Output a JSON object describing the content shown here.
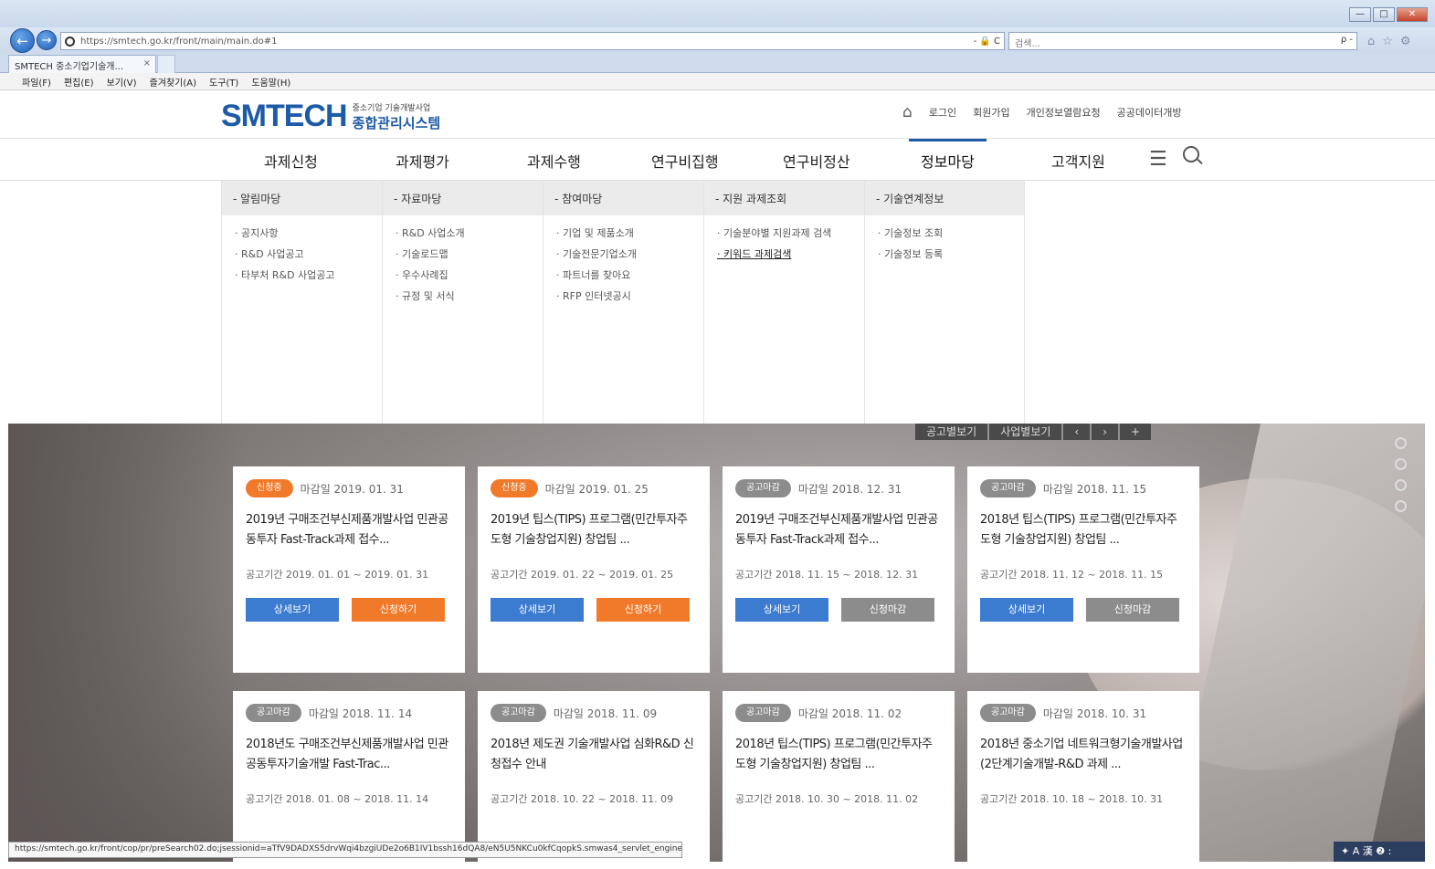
{
  "browser": {
    "url": "https://smtech.go.kr/front/main/main.do#1",
    "url_tail": "- 🔒 C",
    "search_placeholder": "검색...",
    "search_go": "ρ -",
    "tab_title": "SMTECH 중소기업기술개...",
    "menu": [
      "파일(F)",
      "편집(E)",
      "보기(V)",
      "즐겨찾기(A)",
      "도구(T)",
      "도움말(H)"
    ],
    "win_min": "—",
    "win_max": "□",
    "win_close": "✕",
    "tab_close": "×"
  },
  "header": {
    "logo_main": "SMTECH",
    "logo_sub1": "중소기업 기술개발사업",
    "logo_sub2": "종합관리시스템",
    "util": [
      "로그인",
      "회원가입",
      "개인정보열람요청",
      "공공데이터개방"
    ]
  },
  "gnb": [
    "과제신청",
    "과제평가",
    "과제수행",
    "연구비집행",
    "연구비정산",
    "정보마당",
    "고객지원"
  ],
  "mega_menu": [
    {
      "head": "- 알림마당",
      "items": [
        "· 공지사항",
        "· R&D 사업공고",
        "· 타부처 R&D 사업공고"
      ]
    },
    {
      "head": "- 자료마당",
      "items": [
        "· R&D 사업소개",
        "· 기술로드맵",
        "· 우수사례집",
        "· 규정 및 서식"
      ]
    },
    {
      "head": "- 참여마당",
      "items": [
        "· 기업 및 제품소개",
        "· 기술전문기업소개",
        "· 파트너를 찾아요",
        "· RFP 인터넷공시"
      ]
    },
    {
      "head": "- 지원 과제조회",
      "items": [
        "· 기술분야별 지원과제 검색",
        "· 키워드 과제검색"
      ]
    },
    {
      "head": "- 기술연계정보",
      "items": [
        "· 기술정보 조회",
        "· 기술정보 등록"
      ]
    }
  ],
  "hero": {
    "btn_notice": "공고별보기",
    "btn_business": "사업별보기",
    "prev": "‹",
    "next": "›",
    "plus": "+"
  },
  "cards": [
    {
      "badge": "신청중",
      "deadline": "마감일 2019. 01. 31",
      "title": "2019년 구매조건부신제품개발사업 민관공동투자 Fast-Track과제 접수...",
      "period": "공고기간 2019. 01. 01 ~ 2019. 01. 31",
      "detail": "상세보기",
      "apply": "신청하기"
    },
    {
      "badge": "신청중",
      "deadline": "마감일 2019. 01. 25",
      "title": "2019년 팁스(TIPS) 프로그램(민간투자주도형 기술창업지원) 창업팀 ...",
      "period": "공고기간 2019. 01. 22 ~ 2019. 01. 25",
      "detail": "상세보기",
      "apply": "신청하기"
    },
    {
      "badge": "공고마감",
      "deadline": "마감일 2018. 12. 31",
      "title": "2019년 구매조건부신제품개발사업 민관공동투자 Fast-Track과제 접수...",
      "period": "공고기간 2018. 11. 15 ~ 2018. 12. 31",
      "detail": "상세보기",
      "apply": "신청마감"
    },
    {
      "badge": "공고마감",
      "deadline": "마감일 2018. 11. 15",
      "title": "2018년 팁스(TIPS) 프로그램(민간투자주도형 기술창업지원) 창업팀 ...",
      "period": "공고기간 2018. 11. 12 ~ 2018. 11. 15",
      "detail": "상세보기",
      "apply": "신청마감"
    },
    {
      "badge": "공고마감",
      "deadline": "마감일 2018. 11. 14",
      "title": "2018년도 구매조건부신제품개발사업 민관공동투자기술개발 Fast-Trac...",
      "period": "공고기간 2018. 01. 08 ~ 2018. 11. 14"
    },
    {
      "badge": "공고마감",
      "deadline": "마감일 2018. 11. 09",
      "title": "2018년 제도권 기술개발사업 심화R&D 신청접수 안내",
      "period": "공고기간 2018. 10. 22 ~ 2018. 11. 09"
    },
    {
      "badge": "공고마감",
      "deadline": "마감일 2018. 11. 02",
      "title": "2018년 팁스(TIPS) 프로그램(민간투자주도형 기술창업지원) 창업팀 ...",
      "period": "공고기간 2018. 10. 30 ~ 2018. 11. 02"
    },
    {
      "badge": "공고마감",
      "deadline": "마감일 2018. 10. 31",
      "title": "2018년 중소기업 네트워크형기술개발사업(2단계기술개발-R&D 과제 ...",
      "period": "공고기간 2018. 10. 18 ~ 2018. 10. 31"
    }
  ],
  "status_url": "https://smtech.go.kr/front/cop/pr/preSearch02.do;jsessionid=aTfV9DADXS5drvWqi4bzgiUDe2o6B1IV1bssh16dQA8/eN5U5NKCu0kfCqopkS.smwas4_servlet_engine4",
  "ime": "✦ A 漢 ❷ :",
  "colors": {
    "brand": "#1d5aa7",
    "accent": "#f07a2a",
    "closed": "#8c8c8c",
    "detail": "#3b7bd0"
  }
}
